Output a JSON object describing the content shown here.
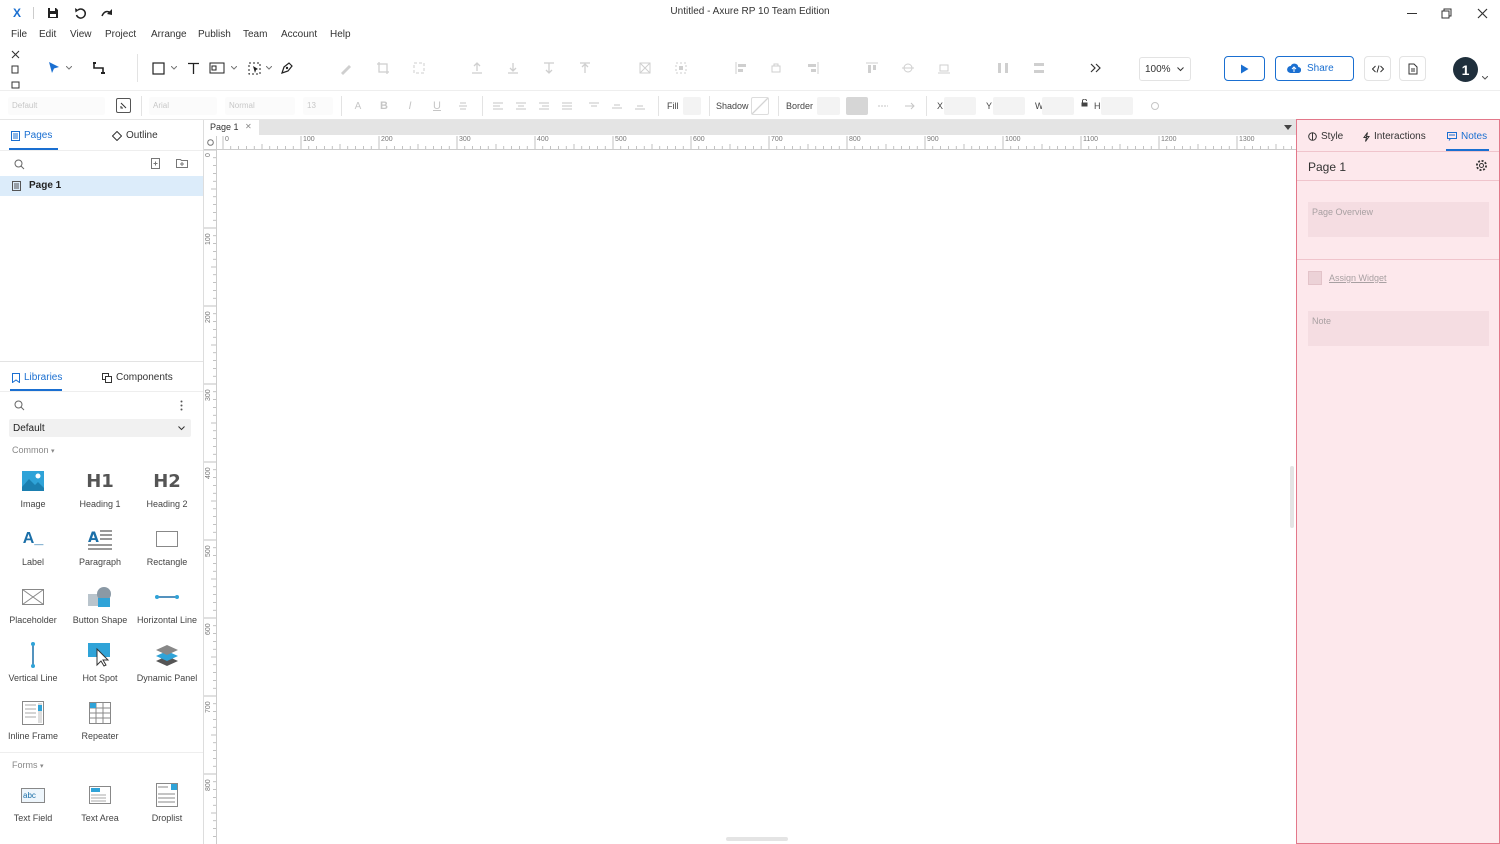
{
  "window": {
    "title": "Untitled - Axure RP 10 Team Edition",
    "logo": "X"
  },
  "menu": [
    "File",
    "Edit",
    "View",
    "Project",
    "Arrange",
    "Publish",
    "Team",
    "Account",
    "Help"
  ],
  "toolbar": {
    "zoom": "100%",
    "share_label": "Share",
    "user_initial": "1"
  },
  "format": {
    "style_value": "Default",
    "font_value": "Arial",
    "weight_value": "Normal",
    "size_value": "13",
    "fill_label": "Fill",
    "shadow_label": "Shadow",
    "border_label": "Border",
    "x_label": "X",
    "y_label": "Y",
    "w_label": "W",
    "h_label": "H"
  },
  "left": {
    "pages_tab": "Pages",
    "outline_tab": "Outline",
    "pages": [
      "Page 1"
    ],
    "libraries_tab": "Libraries",
    "components_tab": "Components",
    "library_select": "Default",
    "common_section": "Common",
    "forms_section": "Forms",
    "common_items": [
      "Image",
      "Heading 1",
      "Heading 2",
      "Label",
      "Paragraph",
      "Rectangle",
      "Placeholder",
      "Button Shape",
      "Horizontal Line",
      "Vertical Line",
      "Hot Spot",
      "Dynamic Panel",
      "Inline Frame",
      "Repeater"
    ],
    "form_items": [
      "Text Field",
      "Text Area",
      "Droplist"
    ],
    "h1_glyph": "H1",
    "h2_glyph": "H2",
    "label_glyph": "A_",
    "textfield_glyph": "abc"
  },
  "canvas": {
    "tab_label": "Page 1",
    "hruler": [
      "0",
      "100",
      "200",
      "300",
      "400",
      "500",
      "600",
      "700",
      "800",
      "900",
      "1000",
      "1100",
      "1200",
      "1300"
    ],
    "vruler": [
      "0",
      "100",
      "200",
      "300",
      "400",
      "500",
      "600",
      "700",
      "800"
    ]
  },
  "right": {
    "style_tab": "Style",
    "interactions_tab": "Interactions",
    "notes_tab": "Notes",
    "page_name": "Page 1",
    "page_overview": "Page Overview",
    "assign_widget": "Assign Widget",
    "note": "Note"
  },
  "colors": {
    "accent": "#1a6fd1",
    "notes_bg": "#fde8ec",
    "notes_border": "#e3788a",
    "library_blue": "#2fa3d8"
  }
}
